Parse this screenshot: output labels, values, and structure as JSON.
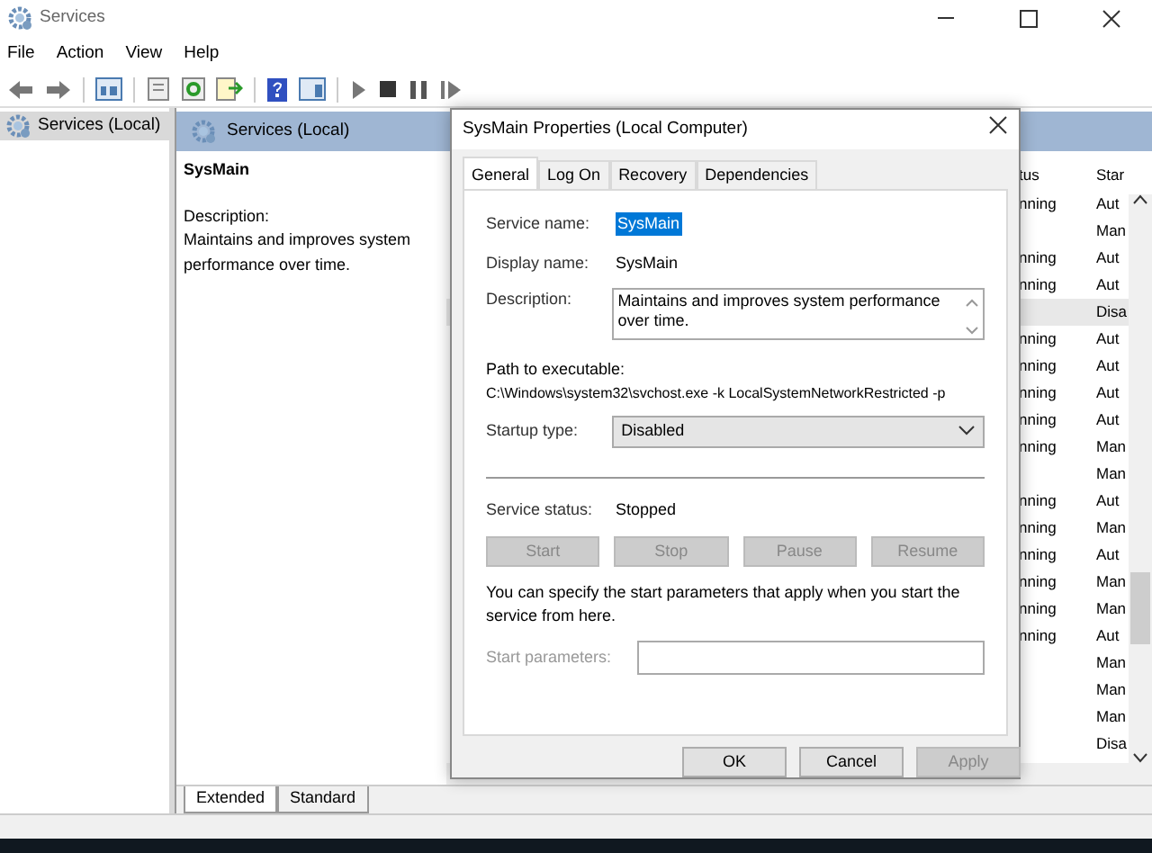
{
  "window": {
    "title": "Services"
  },
  "menu": [
    "File",
    "Action",
    "View",
    "Help"
  ],
  "tree": [
    {
      "label": "Services (Local)",
      "selected": true
    }
  ],
  "pane": {
    "title": "Services (Local)",
    "service_name": "SysMain",
    "description_label": "Description:",
    "description": "Maintains and improves system performance over time."
  },
  "list": {
    "columns": [
      "tus",
      "Star"
    ],
    "rows": [
      {
        "status": "nning",
        "startup": "Aut",
        "selected": false
      },
      {
        "status": "",
        "startup": "Man",
        "selected": false
      },
      {
        "status": "nning",
        "startup": "Aut",
        "selected": false
      },
      {
        "status": "nning",
        "startup": "Aut",
        "selected": false
      },
      {
        "status": "",
        "startup": "Disa",
        "selected": true
      },
      {
        "status": "nning",
        "startup": "Aut",
        "selected": false
      },
      {
        "status": "nning",
        "startup": "Aut",
        "selected": false
      },
      {
        "status": "nning",
        "startup": "Aut",
        "selected": false
      },
      {
        "status": "nning",
        "startup": "Aut",
        "selected": false
      },
      {
        "status": "nning",
        "startup": "Man",
        "selected": false
      },
      {
        "status": "",
        "startup": "Man",
        "selected": false
      },
      {
        "status": "nning",
        "startup": "Aut",
        "selected": false
      },
      {
        "status": "nning",
        "startup": "Man",
        "selected": false
      },
      {
        "status": "nning",
        "startup": "Aut",
        "selected": false
      },
      {
        "status": "nning",
        "startup": "Man",
        "selected": false
      },
      {
        "status": "nning",
        "startup": "Man",
        "selected": false
      },
      {
        "status": "nning",
        "startup": "Aut",
        "selected": false
      },
      {
        "status": "",
        "startup": "Man",
        "selected": false
      },
      {
        "status": "",
        "startup": "Man",
        "selected": false
      },
      {
        "status": "",
        "startup": "Man",
        "selected": false
      },
      {
        "status": "",
        "startup": "Disa",
        "selected": false
      }
    ]
  },
  "view_tabs": [
    {
      "label": "Extended",
      "selected": true
    },
    {
      "label": "Standard",
      "selected": false
    }
  ],
  "dialog": {
    "title": "SysMain Properties (Local Computer)",
    "tabs": [
      {
        "label": "General",
        "selected": true
      },
      {
        "label": "Log On",
        "selected": false
      },
      {
        "label": "Recovery",
        "selected": false
      },
      {
        "label": "Dependencies",
        "selected": false
      }
    ],
    "service_name_label": "Service name:",
    "service_name": "SysMain",
    "display_name_label": "Display name:",
    "display_name": "SysMain",
    "description_label": "Description:",
    "description": "Maintains and improves system performance over time.",
    "path_label": "Path to executable:",
    "path": "C:\\Windows\\system32\\svchost.exe -k LocalSystemNetworkRestricted -p",
    "startup_label": "Startup type:",
    "startup_value": "Disabled",
    "status_label": "Service status:",
    "status_value": "Stopped",
    "service_buttons": [
      {
        "label": "Start",
        "disabled": true
      },
      {
        "label": "Stop",
        "disabled": true
      },
      {
        "label": "Pause",
        "disabled": true
      },
      {
        "label": "Resume",
        "disabled": true
      }
    ],
    "hint": "You can specify the start parameters that apply when you start the service from here.",
    "params_label": "Start parameters:",
    "buttons": [
      {
        "label": "OK",
        "disabled": false
      },
      {
        "label": "Cancel",
        "disabled": false
      },
      {
        "label": "Apply",
        "disabled": true
      }
    ]
  }
}
